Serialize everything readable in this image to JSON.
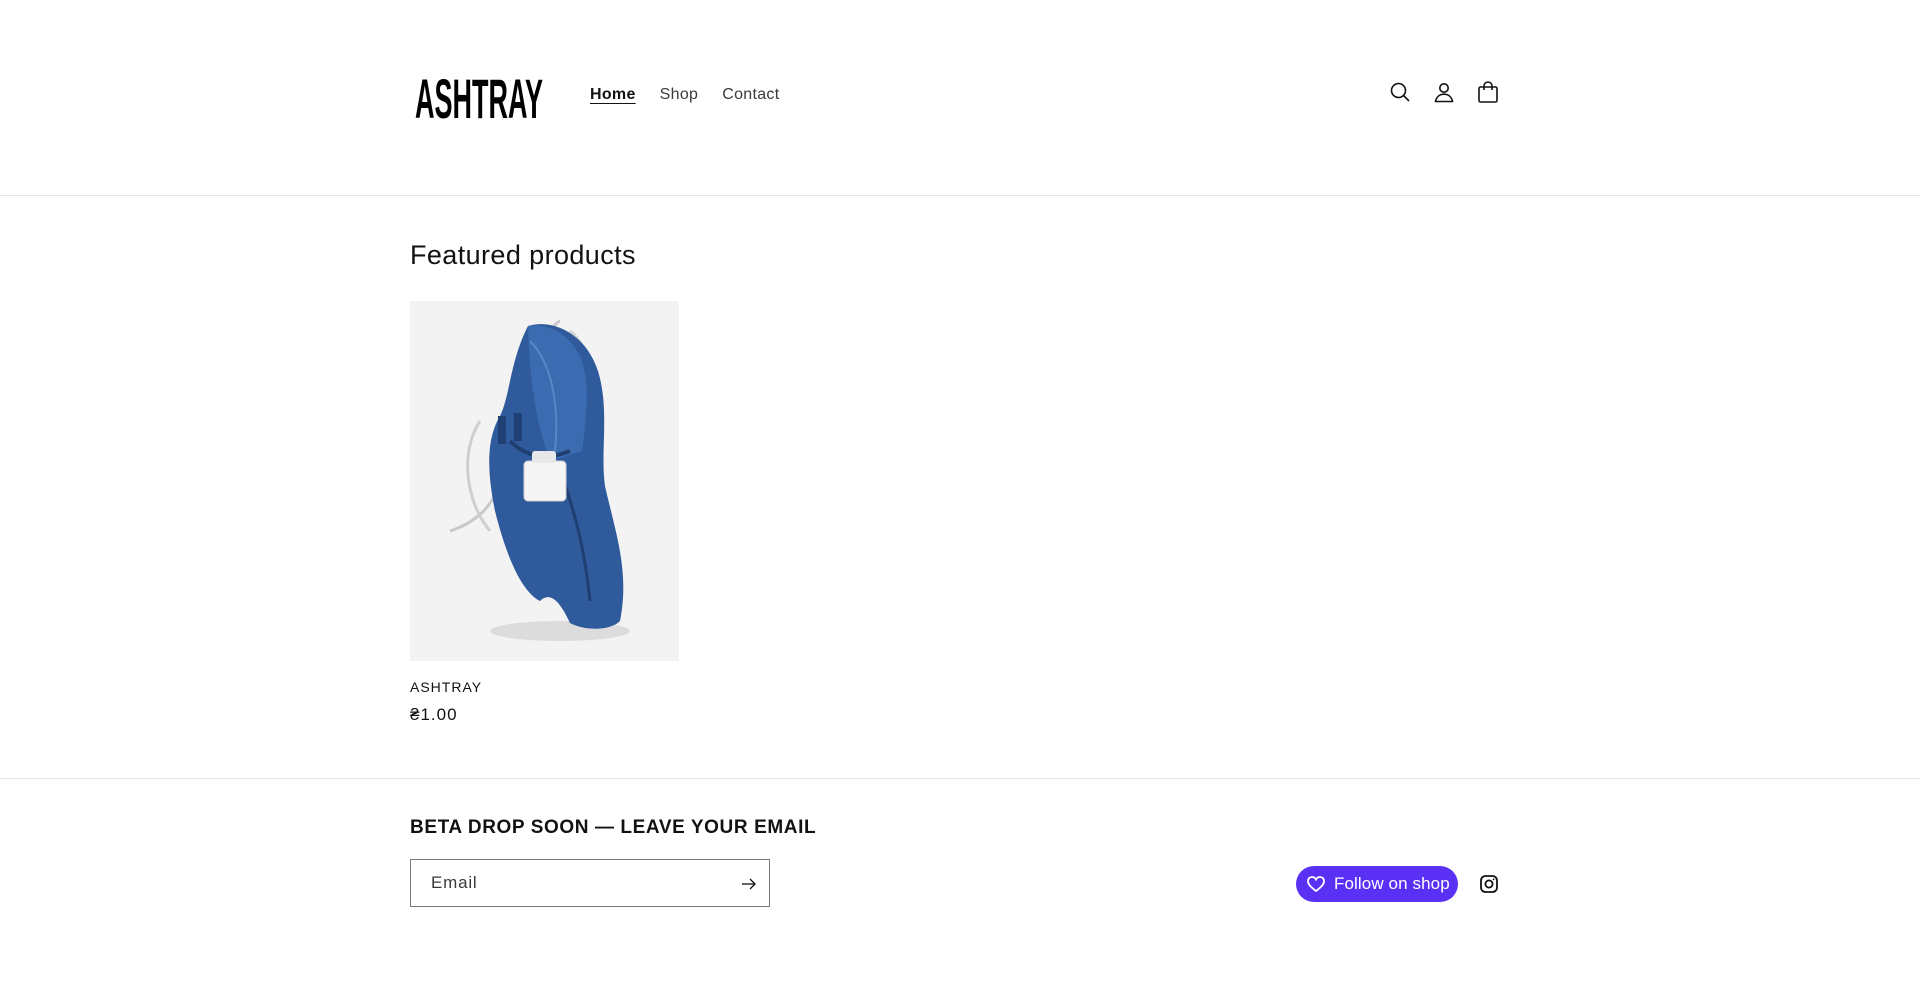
{
  "header": {
    "logo_text": "ASHTRAY",
    "nav": [
      {
        "label": "Home",
        "active": true
      },
      {
        "label": "Shop",
        "active": false
      },
      {
        "label": "Contact",
        "active": false
      }
    ],
    "icons": [
      "search-icon",
      "account-icon",
      "cart-icon"
    ]
  },
  "featured": {
    "title": "Featured products",
    "products": [
      {
        "title": "ASHTRAY",
        "price": "₴1.00",
        "image": "denim-jeans-with-tag"
      }
    ]
  },
  "footer": {
    "newsletter_heading": "BETA DROP SOON — LEAVE YOUR EMAIL",
    "email_placeholder": "Email",
    "submit_icon": "arrow-right-icon",
    "follow_shop_label": "Follow on shop",
    "social": [
      "instagram-icon"
    ]
  },
  "colors": {
    "shop_brand": "#5a31f4",
    "text": "#121212",
    "border": "#e6e6e6"
  }
}
